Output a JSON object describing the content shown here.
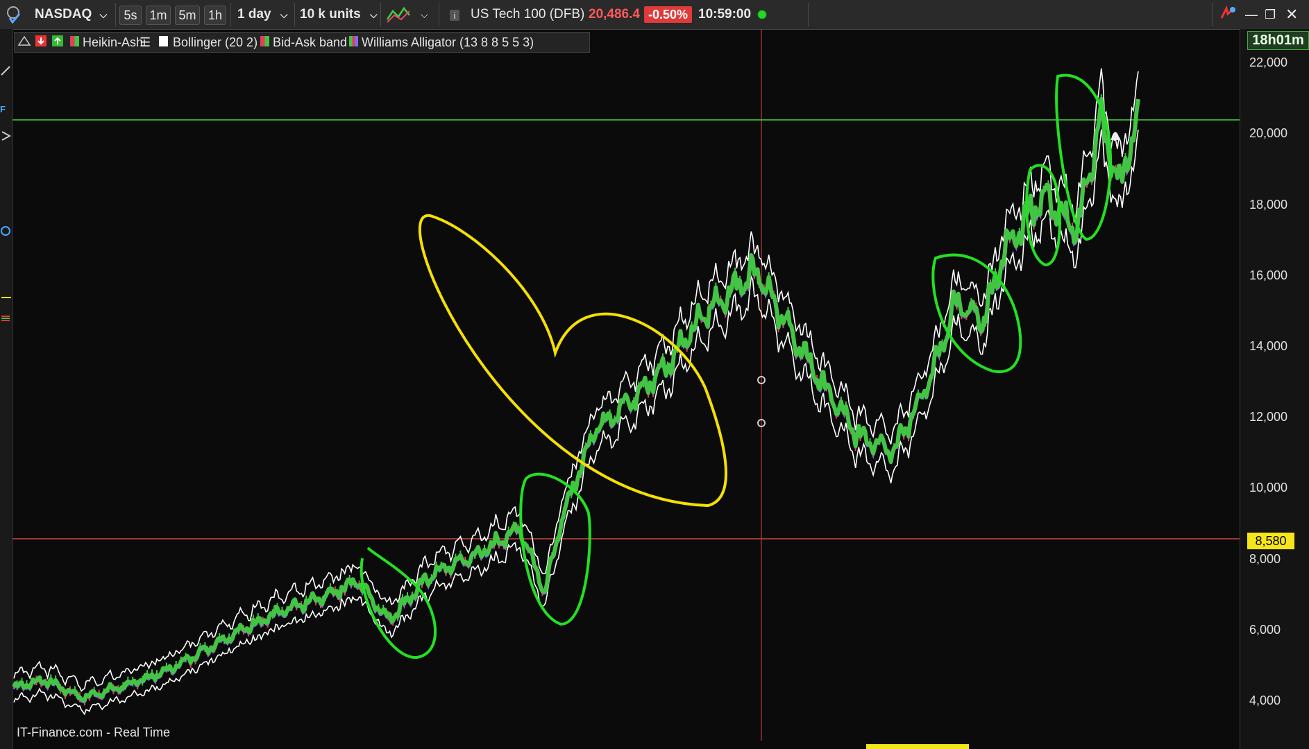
{
  "toolbar": {
    "instrument": "NASDAQ",
    "intervals": [
      "5s",
      "1m",
      "5m",
      "1h"
    ],
    "period": "1 day",
    "units": "10 k units",
    "market_name": "US Tech 100 (DFB)",
    "price": "20,486.4",
    "change": "-0.50%",
    "time": "10:59:00"
  },
  "legend": {
    "items": [
      "Heikin-Ashi",
      "Bollinger (20 2)",
      "Bid-Ask band",
      "Williams Alligator (13 8 8 5 5 3)"
    ]
  },
  "axis": {
    "timer": "18h01m",
    "price_tag": "8,580",
    "labels": [
      "22,000",
      "20,000",
      "18,000",
      "16,000",
      "14,000",
      "12,000",
      "10,000",
      "8,000",
      "6,000",
      "4,000"
    ]
  },
  "footer": {
    "source": "IT-Finance.com - Real Time"
  },
  "colors": {
    "up": "#44c444",
    "down": "#e0405a",
    "band": "#ffffff",
    "alligator": "#7a6cff",
    "annotation_green": "#22e022",
    "annotation_yellow": "#f5e000",
    "hline_green": "#3fd03f",
    "hline_red": "#c04040"
  },
  "chart_data": {
    "type": "line",
    "x": [
      2015.95,
      2016.2,
      2016.5,
      2016.9,
      2017.2,
      2017.6,
      2018.0,
      2018.4,
      2018.7,
      2018.95,
      2019.3,
      2019.7,
      2020.0,
      2020.2,
      2020.35,
      2020.6,
      2020.9,
      2021.2,
      2021.5,
      2021.9,
      2022.2,
      2022.45,
      2022.7,
      2022.8,
      2023.0,
      2023.3,
      2023.5,
      2023.7,
      2023.9,
      2024.2,
      2024.45,
      2024.65,
      2024.8,
      2024.95
    ],
    "y": [
      4400,
      4600,
      4100,
      4500,
      4900,
      5700,
      6400,
      6900,
      7400,
      6300,
      7600,
      8200,
      8900,
      7100,
      9300,
      11700,
      12500,
      13600,
      15000,
      16200,
      14200,
      12800,
      11500,
      11400,
      11100,
      13200,
      15300,
      14700,
      16900,
      18300,
      17200,
      20400,
      18500,
      20500
    ],
    "ylim": [
      3000,
      23000
    ],
    "ylabel": "",
    "series_name": "",
    "horizontal_levels": [
      20400,
      8580
    ]
  }
}
